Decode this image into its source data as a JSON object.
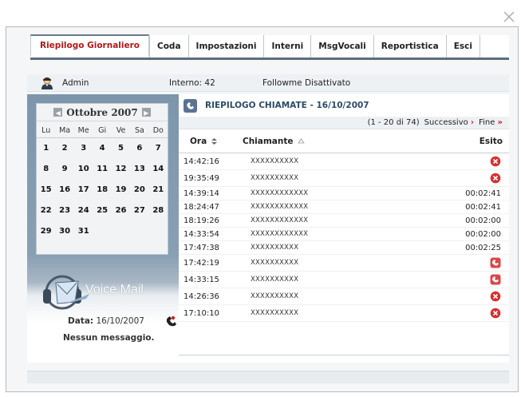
{
  "tabs": [
    {
      "label": "Riepilogo Giornaliero",
      "active": true
    },
    {
      "label": "Coda",
      "active": false
    },
    {
      "label": "Impostazioni",
      "active": false
    },
    {
      "label": "Interni",
      "active": false
    },
    {
      "label": "MsgVocali",
      "active": false
    },
    {
      "label": "Reportistica",
      "active": false
    },
    {
      "label": "Esci",
      "active": false
    }
  ],
  "infobar": {
    "user": "Admin",
    "interno": "Interno: 42",
    "followme": "Followme Disattivato"
  },
  "calendar": {
    "month_label": "Ottobre 2007",
    "weekdays": [
      "Lu",
      "Ma",
      "Me",
      "Gi",
      "Ve",
      "Sa",
      "Do"
    ],
    "weeks": [
      [
        "1",
        "2",
        "3",
        "4",
        "5",
        "6",
        "7"
      ],
      [
        "8",
        "9",
        "10",
        "11",
        "12",
        "13",
        "14"
      ],
      [
        "15",
        "16",
        "17",
        "18",
        "19",
        "20",
        "21"
      ],
      [
        "22",
        "23",
        "24",
        "25",
        "26",
        "27",
        "28"
      ],
      [
        "29",
        "30",
        "31",
        "",
        "",
        "",
        ""
      ]
    ]
  },
  "voicemail": {
    "title": "Voice Mail",
    "date_label": "Data:",
    "date_value": "16/10/2007",
    "message": "Nessun messaggio."
  },
  "main": {
    "title": "RIEPILOGO CHIAMATE - 16/10/2007",
    "pager_range": "(1 - 20 di 74)",
    "pager_next": "Successivo",
    "pager_end": "Fine",
    "columns": {
      "ora": "Ora",
      "chiamante": "Chiamante",
      "esito": "Esito"
    },
    "rows": [
      {
        "ora": "14:42:16",
        "chiamante": "XXXXXXXXXX",
        "esito": "",
        "status": "failed"
      },
      {
        "ora": "19:35:49",
        "chiamante": "XXXXXXXXXX",
        "esito": "",
        "status": "failed"
      },
      {
        "ora": "14:39:14",
        "chiamante": "XXXXXXXXXXXX",
        "esito": "00:02:41",
        "status": "duration"
      },
      {
        "ora": "18:24:47",
        "chiamante": "XXXXXXXXXXXX",
        "esito": "00:02:41",
        "status": "duration"
      },
      {
        "ora": "18:19:26",
        "chiamante": "XXXXXXXXXXXX",
        "esito": "00:02:00",
        "status": "duration"
      },
      {
        "ora": "14:33:54",
        "chiamante": "XXXXXXXXXXXX",
        "esito": "00:02:00",
        "status": "duration"
      },
      {
        "ora": "17:47:38",
        "chiamante": "XXXXXXXXXX",
        "esito": "00:02:25",
        "status": "duration"
      },
      {
        "ora": "17:42:19",
        "chiamante": "XXXXXXXXXX",
        "esito": "",
        "status": "missed"
      },
      {
        "ora": "14:33:15",
        "chiamante": "XXXXXXXXXX",
        "esito": "",
        "status": "missed"
      },
      {
        "ora": "14:26:36",
        "chiamante": "XXXXXXXXXX",
        "esito": "",
        "status": "failed"
      },
      {
        "ora": "17:10:10",
        "chiamante": "XXXXXXXXXX",
        "esito": "",
        "status": "failed"
      }
    ]
  },
  "colors": {
    "accent_red": "#b01818",
    "failed_icon": "#d63030",
    "missed_icon": "#d84a4a",
    "title_blue": "#2b4a66"
  },
  "icons": {
    "close": "close-icon",
    "user": "user-icon",
    "prev": "chevron-left-icon",
    "next": "chevron-right-icon",
    "phone": "phone-icon",
    "failed": "cross-circle-icon",
    "missed": "missed-call-icon"
  }
}
